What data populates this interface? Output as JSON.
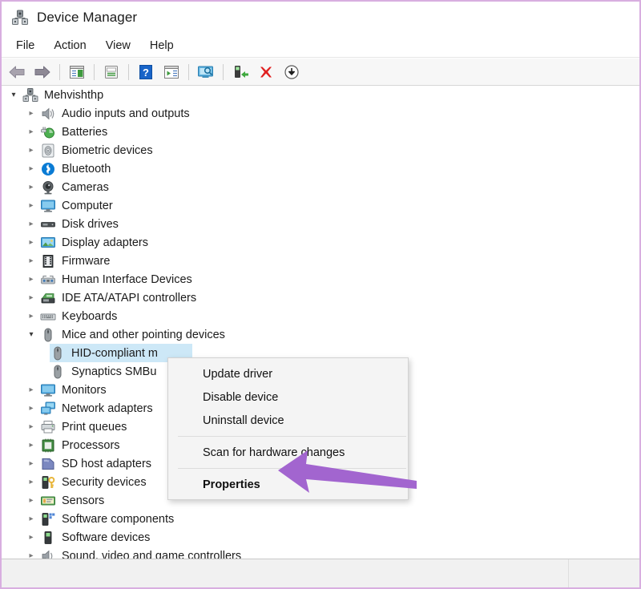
{
  "window": {
    "title": "Device Manager",
    "icon": "device-manager-icon",
    "border_color": "#d8aee0"
  },
  "menubar": {
    "items": [
      {
        "label": "File"
      },
      {
        "label": "Action"
      },
      {
        "label": "View"
      },
      {
        "label": "Help"
      }
    ]
  },
  "toolbar": {
    "buttons": [
      {
        "icon": "back-arrow-icon",
        "tooltip": "Back"
      },
      {
        "icon": "forward-arrow-icon",
        "tooltip": "Forward"
      },
      {
        "icon": "show-hide-console-tree-icon",
        "tooltip": "Show/Hide Console Tree"
      },
      {
        "icon": "properties-icon",
        "tooltip": "Properties"
      },
      {
        "icon": "help-icon",
        "tooltip": "Help"
      },
      {
        "icon": "show-hide-action-pane-icon",
        "tooltip": "Show/Hide Action Pane"
      },
      {
        "icon": "scan-for-hardware-changes-icon",
        "tooltip": "Scan for hardware changes"
      },
      {
        "icon": "enable-device-icon",
        "tooltip": "Enable device"
      },
      {
        "icon": "uninstall-device-icon",
        "tooltip": "Uninstall device"
      },
      {
        "icon": "update-driver-icon",
        "tooltip": "Update driver"
      }
    ]
  },
  "tree": {
    "root": {
      "label": "Mehvishthp",
      "icon": "computer-hub-icon",
      "expanded": true,
      "level": 0
    },
    "items": [
      {
        "label": "Audio inputs and outputs",
        "icon": "speaker-icon",
        "expanded": false,
        "level": 1
      },
      {
        "label": "Batteries",
        "icon": "battery-icon",
        "expanded": false,
        "level": 1
      },
      {
        "label": "Biometric devices",
        "icon": "fingerprint-icon",
        "expanded": false,
        "level": 1
      },
      {
        "label": "Bluetooth",
        "icon": "bluetooth-icon",
        "expanded": false,
        "level": 1
      },
      {
        "label": "Cameras",
        "icon": "camera-icon",
        "expanded": false,
        "level": 1
      },
      {
        "label": "Computer",
        "icon": "monitor-icon",
        "expanded": false,
        "level": 1
      },
      {
        "label": "Disk drives",
        "icon": "disk-drive-icon",
        "expanded": false,
        "level": 1
      },
      {
        "label": "Display adapters",
        "icon": "display-adapter-icon",
        "expanded": false,
        "level": 1
      },
      {
        "label": "Firmware",
        "icon": "firmware-chip-icon",
        "expanded": false,
        "level": 1
      },
      {
        "label": "Human Interface Devices",
        "icon": "hid-icon",
        "expanded": false,
        "level": 1
      },
      {
        "label": "IDE ATA/ATAPI controllers",
        "icon": "ide-controller-icon",
        "expanded": false,
        "level": 1
      },
      {
        "label": "Keyboards",
        "icon": "keyboard-icon",
        "expanded": false,
        "level": 1
      },
      {
        "label": "Mice and other pointing devices",
        "icon": "mouse-icon",
        "expanded": true,
        "level": 1
      },
      {
        "label": "HID-compliant m",
        "icon": "mouse-icon",
        "expanded": null,
        "level": 2,
        "selected": true
      },
      {
        "label": "Synaptics SMBu",
        "icon": "mouse-icon",
        "expanded": null,
        "level": 2
      },
      {
        "label": "Monitors",
        "icon": "monitor-icon",
        "expanded": false,
        "level": 1
      },
      {
        "label": "Network adapters",
        "icon": "network-adapter-icon",
        "expanded": false,
        "level": 1
      },
      {
        "label": "Print queues",
        "icon": "printer-icon",
        "expanded": false,
        "level": 1
      },
      {
        "label": "Processors",
        "icon": "processor-icon",
        "expanded": false,
        "level": 1
      },
      {
        "label": "SD host adapters",
        "icon": "sd-card-icon",
        "expanded": false,
        "level": 1
      },
      {
        "label": "Security devices",
        "icon": "security-key-icon",
        "expanded": false,
        "level": 1
      },
      {
        "label": "Sensors",
        "icon": "sensor-icon",
        "expanded": false,
        "level": 1
      },
      {
        "label": "Software components",
        "icon": "software-component-icon",
        "expanded": false,
        "level": 1
      },
      {
        "label": "Software devices",
        "icon": "software-device-icon",
        "expanded": false,
        "level": 1
      },
      {
        "label": "Sound, video and game controllers",
        "icon": "sound-controller-icon",
        "expanded": false,
        "level": 1
      }
    ]
  },
  "context_menu": {
    "items": [
      {
        "label": "Update driver",
        "bold": false,
        "separator_before": false
      },
      {
        "label": "Disable device",
        "bold": false,
        "separator_before": false
      },
      {
        "label": "Uninstall device",
        "bold": false,
        "separator_before": false
      },
      {
        "label": "Scan for hardware changes",
        "bold": false,
        "separator_before": true
      },
      {
        "label": "Properties",
        "bold": true,
        "separator_before": true
      }
    ]
  },
  "annotation": {
    "arrow": "left-pointing-arrow",
    "color": "#a265cf",
    "points_to": "Properties"
  },
  "statusbar": {
    "text": ""
  }
}
